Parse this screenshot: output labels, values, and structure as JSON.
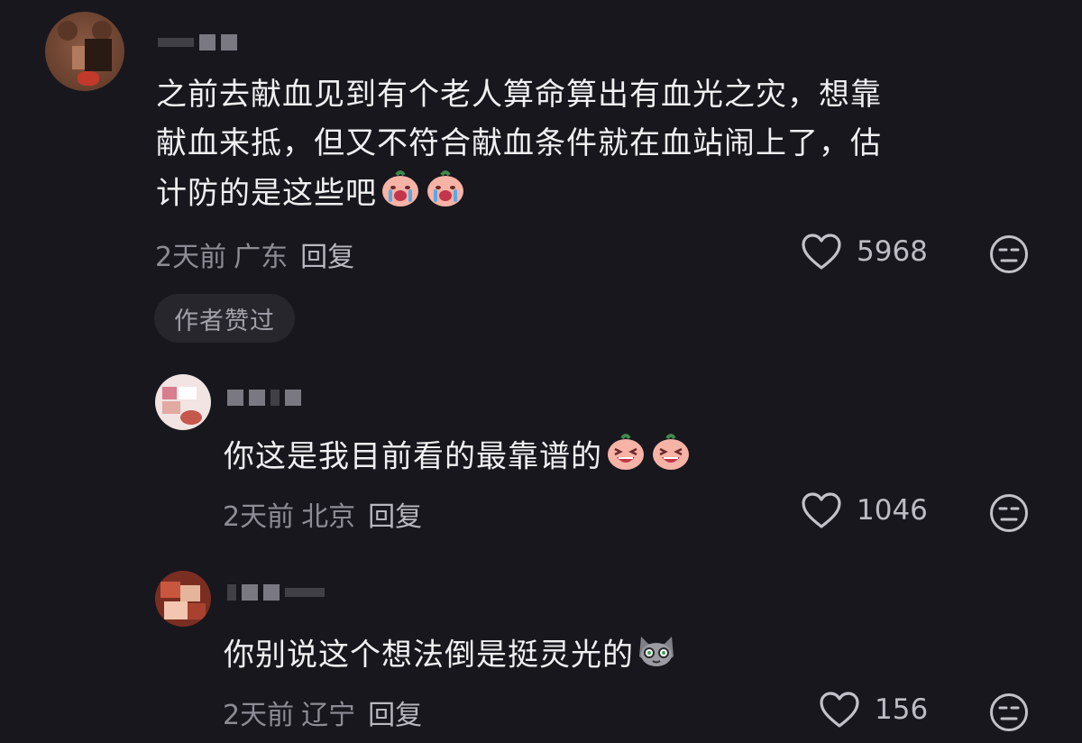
{
  "comments": [
    {
      "text": "之前去献血见到有个老人算命算出有血光之灾，想靠献血来抵，但又不符合献血条件就在血站闹上了，估计防的是这些吧",
      "lines": [
        "之前去献血见到有个老人算命算出有血光之灾，想靠",
        "献血来抵，但又不符合献血条件就在血站闹上了，估",
        "计防的是这些吧"
      ],
      "emoji": [
        "crying-emoji",
        "crying-emoji"
      ],
      "time": "2天前",
      "location": "广东",
      "reply_label": "回复",
      "likes": "5968",
      "badge": "作者赞过"
    }
  ],
  "replies": [
    {
      "text": "你这是我目前看的最靠谱的",
      "emoji": [
        "laughing-emoji",
        "laughing-emoji"
      ],
      "time": "2天前",
      "location": "北京",
      "reply_label": "回复",
      "likes": "1046"
    },
    {
      "text": "你别说这个想法倒是挺灵光的",
      "emoji": [
        "cat-emoji"
      ],
      "time": "2天前",
      "location": "辽宁",
      "reply_label": "回复",
      "likes": "156"
    }
  ],
  "colors": {
    "background": "#18171d",
    "text": "#f0f0f2",
    "meta": "#8d8c95",
    "badge_bg": "#27262d"
  }
}
